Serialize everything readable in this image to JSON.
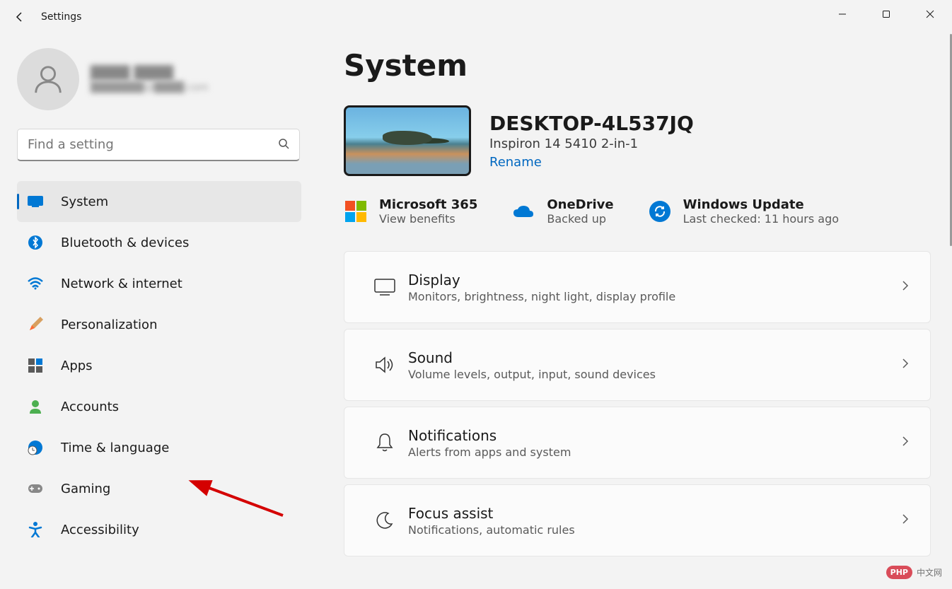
{
  "app": {
    "title": "Settings"
  },
  "user": {
    "name_blurred": "████ ████",
    "email_blurred": "███████@████.com"
  },
  "search": {
    "placeholder": "Find a setting"
  },
  "nav": [
    {
      "id": "system",
      "label": "System",
      "active": true
    },
    {
      "id": "bluetooth",
      "label": "Bluetooth & devices",
      "active": false
    },
    {
      "id": "network",
      "label": "Network & internet",
      "active": false
    },
    {
      "id": "personalization",
      "label": "Personalization",
      "active": false
    },
    {
      "id": "apps",
      "label": "Apps",
      "active": false
    },
    {
      "id": "accounts",
      "label": "Accounts",
      "active": false
    },
    {
      "id": "time",
      "label": "Time & language",
      "active": false
    },
    {
      "id": "gaming",
      "label": "Gaming",
      "active": false
    },
    {
      "id": "accessibility",
      "label": "Accessibility",
      "active": false
    }
  ],
  "page": {
    "title": "System"
  },
  "device": {
    "name": "DESKTOP-4L537JQ",
    "model": "Inspiron 14 5410 2-in-1",
    "rename_label": "Rename"
  },
  "status": {
    "ms365_title": "Microsoft 365",
    "ms365_sub": "View benefits",
    "onedrive_title": "OneDrive",
    "onedrive_sub": "Backed up",
    "update_title": "Windows Update",
    "update_sub": "Last checked: 11 hours ago"
  },
  "cards": {
    "display_title": "Display",
    "display_desc": "Monitors, brightness, night light, display profile",
    "sound_title": "Sound",
    "sound_desc": "Volume levels, output, input, sound devices",
    "notifications_title": "Notifications",
    "notifications_desc": "Alerts from apps and system",
    "focus_title": "Focus assist",
    "focus_desc": "Notifications, automatic rules"
  },
  "watermark": {
    "logo": "PHP",
    "text": "中文网"
  }
}
